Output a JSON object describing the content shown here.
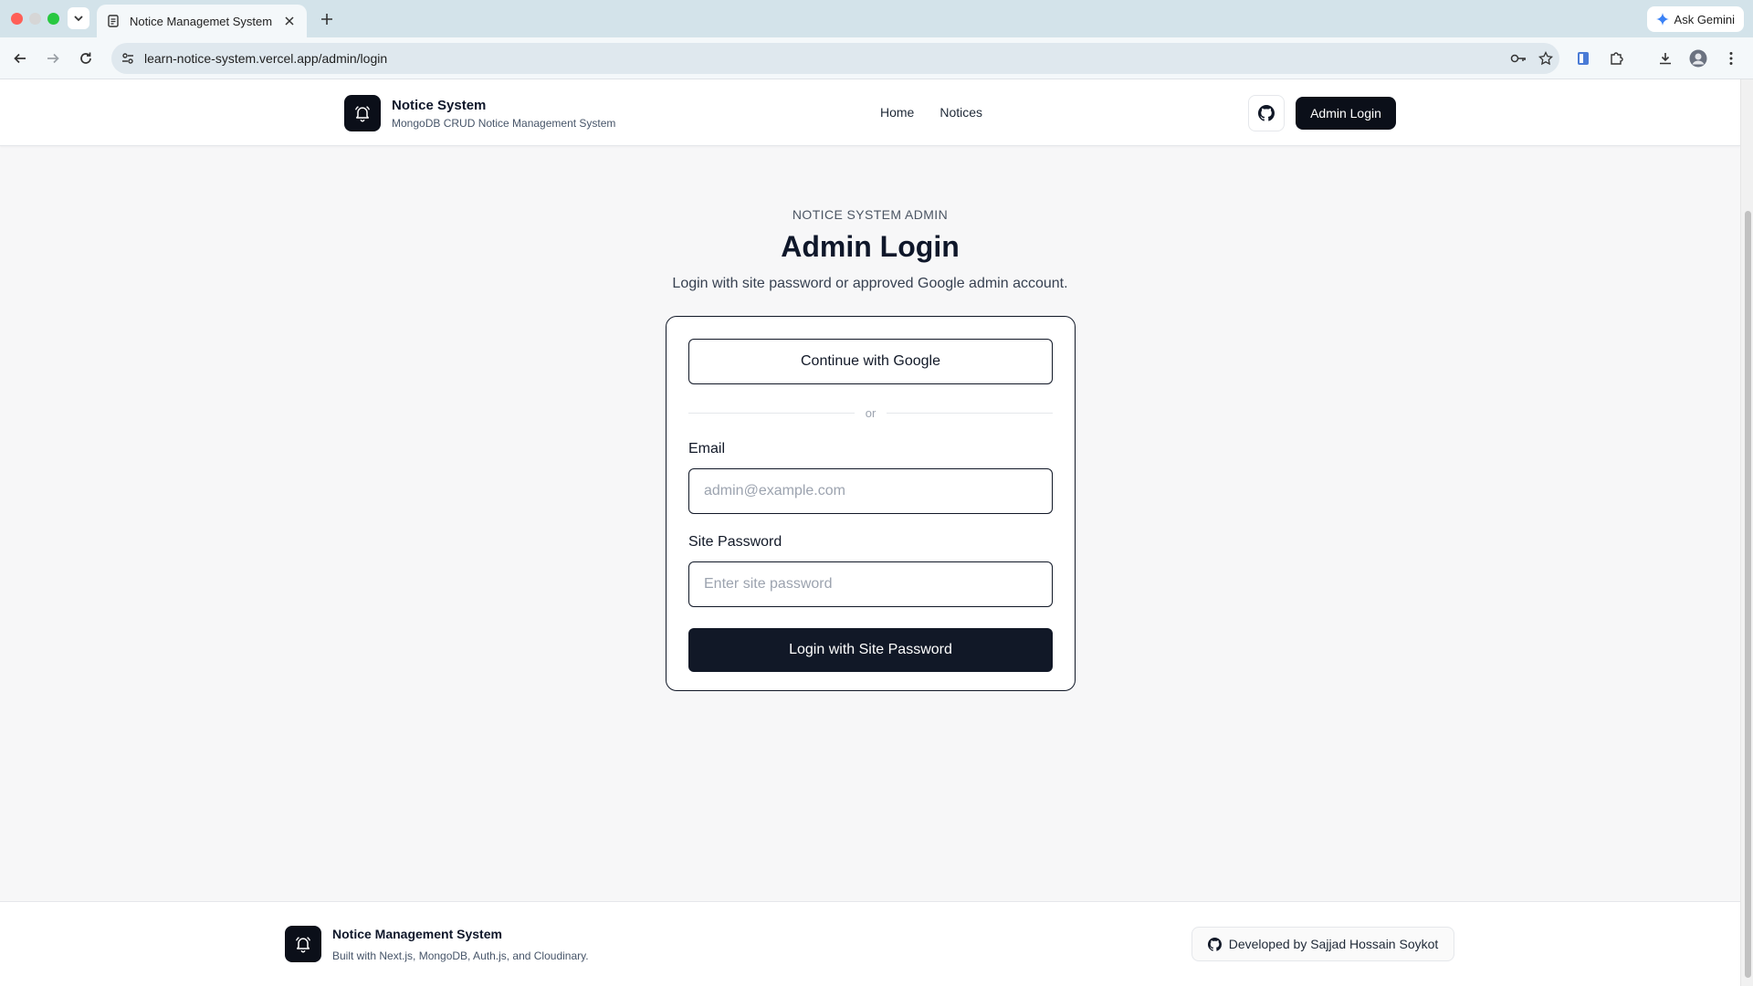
{
  "browser": {
    "tab_title": "Notice Managemet System",
    "url": "learn-notice-system.vercel.app/admin/login",
    "gemini_label": "Ask Gemini"
  },
  "header": {
    "brand_title": "Notice System",
    "brand_subtitle": "MongoDB CRUD Notice Management System",
    "nav": [
      {
        "label": "Home"
      },
      {
        "label": "Notices"
      }
    ],
    "admin_login_label": "Admin Login"
  },
  "hero": {
    "eyebrow": "NOTICE SYSTEM ADMIN",
    "title": "Admin Login",
    "description": "Login with site password or approved Google admin account."
  },
  "login_form": {
    "google_label": "Continue with Google",
    "divider_text": "or",
    "email_label": "Email",
    "email_placeholder": "admin@example.com",
    "email_value": "",
    "password_label": "Site Password",
    "password_placeholder": "Enter site password",
    "password_value": "",
    "submit_label": "Login with Site Password"
  },
  "footer": {
    "title": "Notice Management System",
    "subtitle": "Built with Next.js, MongoDB, Auth.js, and Cloudinary.",
    "developer": "Developed by Sajjad Hossain Soykot"
  },
  "colors": {
    "primary_dark": "#0b0f19",
    "page_bg": "#f7f7f8",
    "tabstrip_bg": "#d3e3ea"
  }
}
